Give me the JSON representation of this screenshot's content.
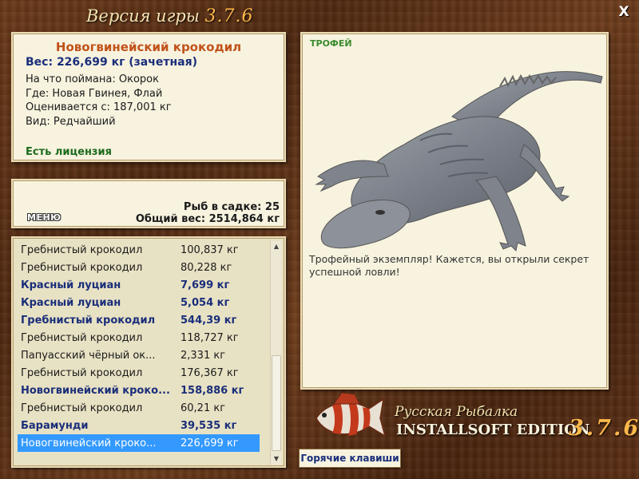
{
  "window": {
    "title_prefix": "Версия игры",
    "title_version": "3.7.6",
    "close_label": "X"
  },
  "fish_info": {
    "title": "Новогвинейский крокодил",
    "weight": "Вес: 226,699 кг (зачетная)",
    "bait": "На что поймана: Окорок",
    "location": "Где: Новая Гвинея, Флай",
    "rated_from": "Оценивается с: 187,001 кг",
    "rarity": "Вид: Редчайший",
    "license": "Есть лицензия"
  },
  "menu": {
    "menu_label": "МЕНЮ",
    "fish_count": "Рыб в садке: 25",
    "total_weight": "Общий вес: 2514,864 кг"
  },
  "catch_list": [
    {
      "name": "Гребнистый крокодил",
      "weight": "100,837 кг",
      "bold": false,
      "selected": false
    },
    {
      "name": "Гребнистый крокодил",
      "weight": "80,228 кг",
      "bold": false,
      "selected": false
    },
    {
      "name": "Красный луциан",
      "weight": "7,699 кг",
      "bold": true,
      "selected": false
    },
    {
      "name": "Красный луциан",
      "weight": "5,054 кг",
      "bold": true,
      "selected": false
    },
    {
      "name": "Гребнистый крокодил",
      "weight": "544,39 кг",
      "bold": true,
      "selected": false
    },
    {
      "name": "Гребнистый крокодил",
      "weight": "118,727 кг",
      "bold": false,
      "selected": false
    },
    {
      "name": "Папуасский чёрный ок...",
      "weight": "2,331 кг",
      "bold": false,
      "selected": false
    },
    {
      "name": "Гребнистый крокодил",
      "weight": "176,367 кг",
      "bold": false,
      "selected": false
    },
    {
      "name": "Новогвинейский кроко...",
      "weight": "158,886 кг",
      "bold": true,
      "selected": false
    },
    {
      "name": "Гребнистый крокодил",
      "weight": "60,21 кг",
      "bold": false,
      "selected": false
    },
    {
      "name": "Барамунди",
      "weight": "39,535 кг",
      "bold": true,
      "selected": false
    },
    {
      "name": "Новогвинейский кроко...",
      "weight": "226,699 кг",
      "bold": false,
      "selected": true
    }
  ],
  "trophy": {
    "label": "ТРОФЕЙ",
    "text": "Трофейный экземпляр! Кажется, вы открыли секрет успешной ловли!"
  },
  "branding": {
    "line1": "Русская Рыбалка",
    "line2": "INSTALLSOFT EDITION",
    "version": "3.7.6"
  },
  "hotkeys_label": "Горячие клавиши",
  "colors": {
    "accent_orange": "#c0521a",
    "bold_blue": "#1a2e7a",
    "license_green": "#1e6b1e",
    "selection_blue": "#3399ff",
    "version_gold": "#ffb84a"
  }
}
